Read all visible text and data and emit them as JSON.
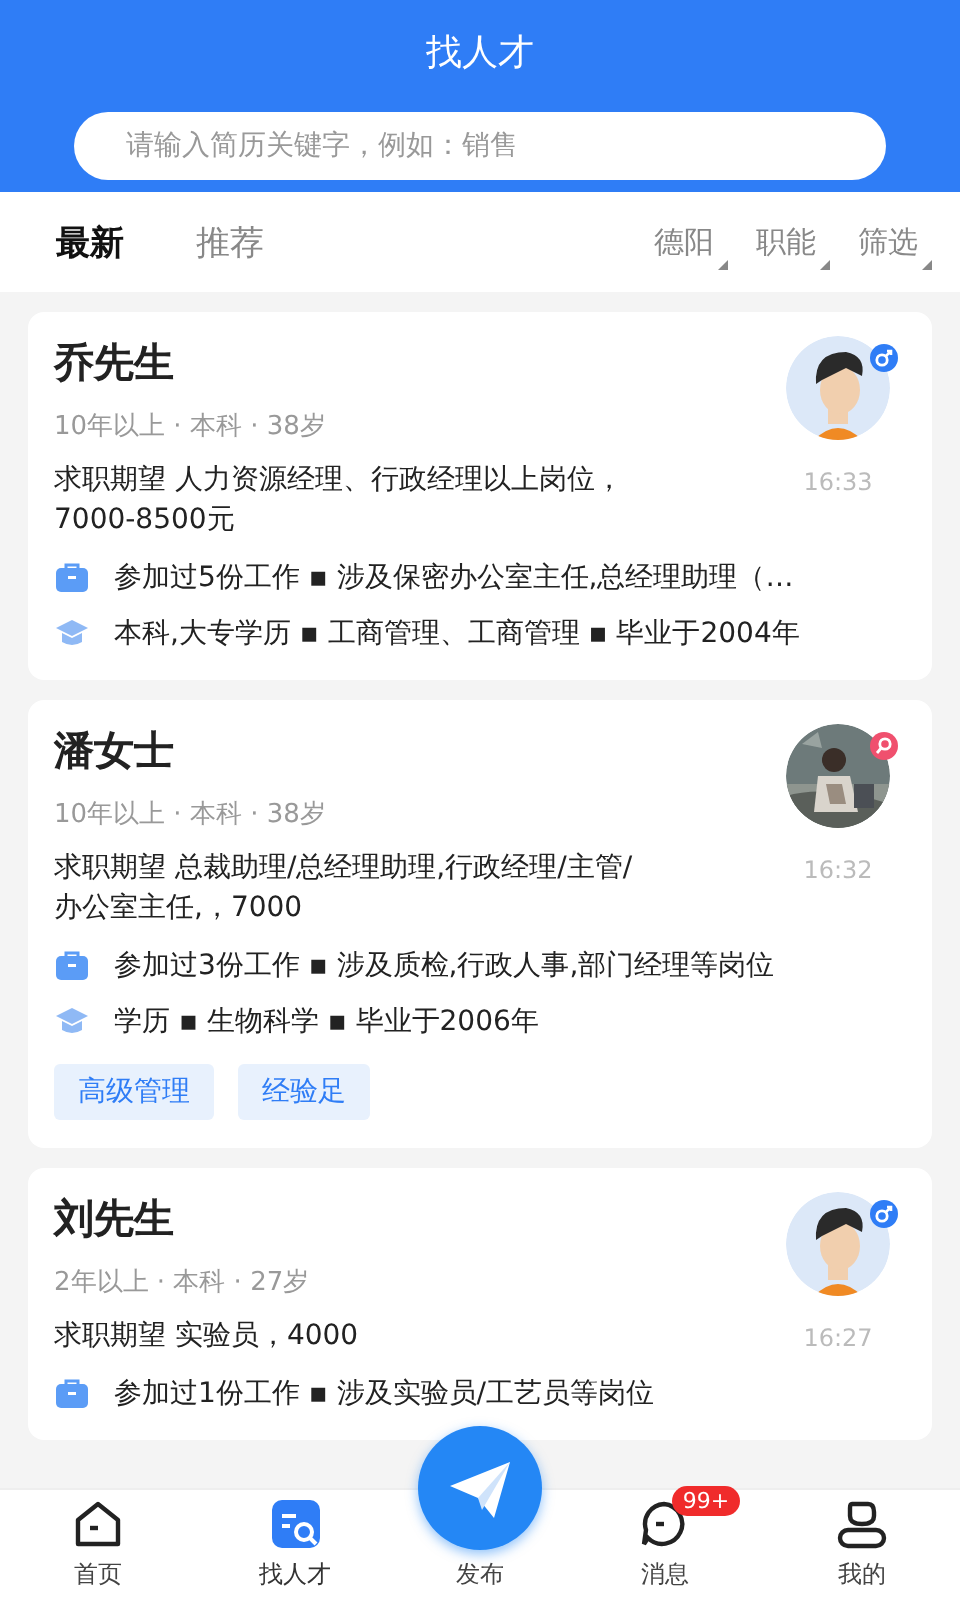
{
  "header": {
    "title": "找人才",
    "search": {
      "placeholder": "请输入简历关键字，例如：销售"
    }
  },
  "tabs": [
    {
      "label": "最新",
      "selected": true
    },
    {
      "label": "推荐",
      "selected": false
    }
  ],
  "filters": [
    "德阳",
    "职能",
    "筛选"
  ],
  "candidates": [
    {
      "name": "乔先生",
      "meta": "10年以上 · 本科 · 38岁",
      "avatar": {
        "kind": "cartoon"
      },
      "gender": {
        "kind": "male",
        "color": "#2f7df6"
      },
      "time": "16:33",
      "expectation": "求职期望 人力资源经理、行政经理以上岗位，7000-8500元",
      "work": "参加过5份工作 ▪ 涉及保密办公室主任,总经理助理（…",
      "education": "本科,大专学历 ▪ 工商管理、工商管理 ▪ 毕业于2004年"
    },
    {
      "name": "潘女士",
      "meta": "10年以上 · 本科 · 38岁",
      "avatar": {
        "kind": "picture"
      },
      "gender": {
        "kind": "female",
        "color": "#f0506e"
      },
      "time": "16:32",
      "expectation": "求职期望 总裁助理/总经理助理,行政经理/主管/办公室主任,，7000",
      "work": "参加过3份工作 ▪ 涉及质检,行政人事,部门经理等岗位",
      "education": "学历 ▪ 生物科学 ▪ 毕业于2006年",
      "tags": [
        "高级管理",
        "经验足"
      ]
    },
    {
      "name": "刘先生",
      "meta": "2年以上 · 本科 · 27岁",
      "avatar": {
        "kind": "cartoon"
      },
      "gender": {
        "kind": "male",
        "color": "#2f7df6"
      },
      "time": "16:27",
      "expectation": "求职期望 实验员，4000",
      "work": "参加过1份工作 ▪ 涉及实验员/工艺员等岗位"
    }
  ],
  "nav": [
    {
      "kind": "home",
      "label": "首页",
      "selected": false
    },
    {
      "kind": "talent",
      "label": "找人才",
      "selected": true
    },
    {
      "kind": "publish",
      "label": "发布",
      "selected": false
    },
    {
      "kind": "message",
      "label": "消息",
      "selected": false,
      "badge": "99+"
    },
    {
      "kind": "profile",
      "label": "我的",
      "selected": false
    }
  ]
}
